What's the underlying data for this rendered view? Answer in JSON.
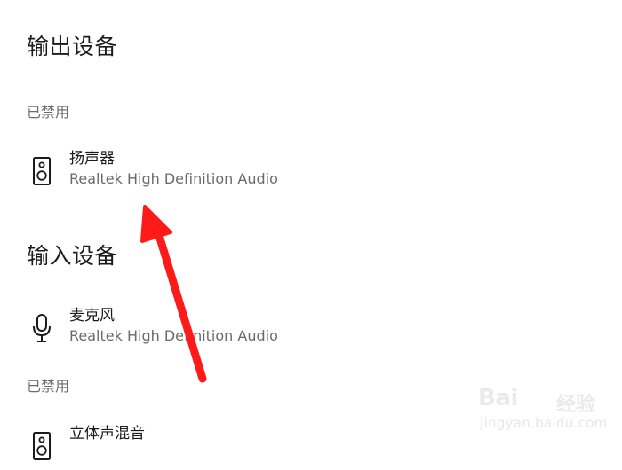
{
  "output": {
    "title": "输出设备",
    "disabled_label": "已禁用",
    "devices": [
      {
        "name": "扬声器",
        "description": "Realtek High Definition Audio",
        "icon": "speaker-icon"
      }
    ]
  },
  "input": {
    "title": "输入设备",
    "devices": [
      {
        "name": "麦克风",
        "description": "Realtek High Definition Audio",
        "icon": "microphone-icon"
      }
    ],
    "disabled_label": "已禁用",
    "disabled_devices": [
      {
        "name": "立体声混音",
        "icon": "speaker-icon"
      }
    ]
  },
  "annotation": {
    "arrow_color": "#ff1a1a"
  },
  "watermark": {
    "logo": "Bai",
    "brand": "经验",
    "url": "jingyan.baidu.com"
  }
}
